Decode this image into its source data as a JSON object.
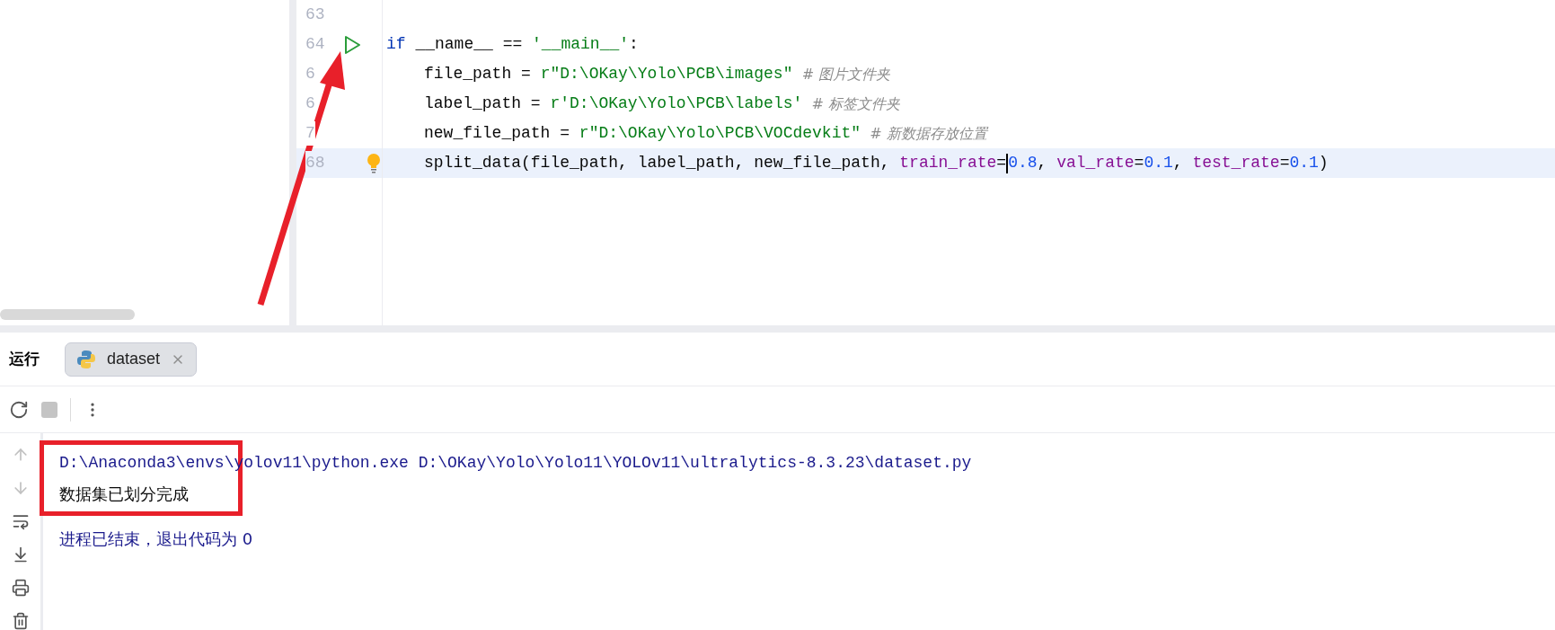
{
  "editor": {
    "lines": [
      {
        "number": "63",
        "run_marker": false,
        "highlighted": false,
        "bulb": false
      },
      {
        "number": "64",
        "run_marker": true,
        "highlighted": false,
        "bulb": false,
        "indent": false,
        "tokens": [
          {
            "kind": "keyword",
            "text": "if"
          },
          {
            "kind": "plain",
            "text": " __name__ == "
          },
          {
            "kind": "string",
            "text": "'__main__'"
          },
          {
            "kind": "plain",
            "text": ":"
          }
        ]
      },
      {
        "number": "6",
        "run_marker": false,
        "highlighted": false,
        "bulb": false,
        "indent": true,
        "tokens": [
          {
            "kind": "plain",
            "text": "file_path = "
          },
          {
            "kind": "string",
            "text": "r\"D:\\OKay\\Yolo\\PCB\\images\""
          },
          {
            "kind": "comment",
            "text": "  # 图片文件夹"
          }
        ]
      },
      {
        "number": "6",
        "run_marker": false,
        "highlighted": false,
        "bulb": false,
        "indent": true,
        "tokens": [
          {
            "kind": "plain",
            "text": "label_path = "
          },
          {
            "kind": "string",
            "text": "r'D:\\OKay\\Yolo\\PCB\\labels'"
          },
          {
            "kind": "comment",
            "text": "  # 标签文件夹"
          }
        ]
      },
      {
        "number": "7",
        "run_marker": false,
        "highlighted": false,
        "bulb": false,
        "indent": true,
        "tokens": [
          {
            "kind": "plain",
            "text": "new_file_path = "
          },
          {
            "kind": "string",
            "text": "r\"D:\\OKay\\Yolo\\PCB\\VOCdevkit\""
          },
          {
            "kind": "comment",
            "text": "  # 新数据存放位置"
          }
        ]
      },
      {
        "number": "68",
        "run_marker": false,
        "highlighted": true,
        "bulb": true,
        "indent": true,
        "tokens": [
          {
            "kind": "plain",
            "text": "split_data(file_path, label_path, new_file_path, "
          },
          {
            "kind": "param",
            "text": "train_rate"
          },
          {
            "kind": "plain",
            "text": "=",
            "caret_after": true
          },
          {
            "kind": "number",
            "text": "0.8"
          },
          {
            "kind": "plain",
            "text": ", "
          },
          {
            "kind": "param",
            "text": "val_rate"
          },
          {
            "kind": "plain",
            "text": "="
          },
          {
            "kind": "number",
            "text": "0.1"
          },
          {
            "kind": "plain",
            "text": ", "
          },
          {
            "kind": "param",
            "text": "test_rate"
          },
          {
            "kind": "plain",
            "text": "="
          },
          {
            "kind": "number",
            "text": "0.1"
          },
          {
            "kind": "plain",
            "text": ")"
          }
        ]
      }
    ]
  },
  "run_panel": {
    "title": "运行",
    "tabs": [
      {
        "label": "dataset",
        "selected": true
      }
    ],
    "console": [
      {
        "kind": "command",
        "text": "D:\\Anaconda3\\envs\\yolov11\\python.exe D:\\OKay\\Yolo\\Yolo11\\YOLOv11\\ultralytics-8.3.23\\dataset.py"
      },
      {
        "kind": "output",
        "text": "数据集已划分完成"
      },
      {
        "kind": "exit",
        "text": "进程已结束，退出代码为 0"
      }
    ]
  }
}
